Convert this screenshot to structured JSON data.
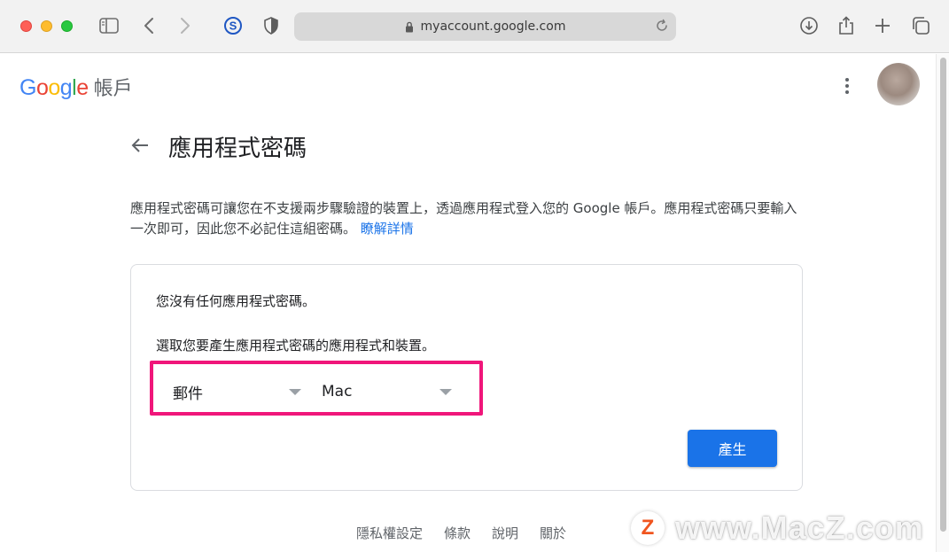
{
  "browser": {
    "url": "myaccount.google.com",
    "icons": [
      "sidebar-icon",
      "back-icon",
      "forward-icon",
      "extension-s-icon",
      "privacy-shield-icon",
      "lock-icon",
      "reload-icon",
      "download-icon",
      "share-icon",
      "new-tab-icon",
      "tab-overview-icon"
    ]
  },
  "header": {
    "logo_google": "Google",
    "logo_suffix": "帳戶"
  },
  "page": {
    "title": "應用程式密碼",
    "description": "應用程式密碼可讓您在不支援兩步驟驗證的裝置上，透過應用程式登入您的 Google 帳戶。應用程式密碼只要輸入一次即可，因此您不必記住這組密碼。",
    "learn_more": "瞭解詳情"
  },
  "card": {
    "no_passwords": "您沒有任何應用程式密碼。",
    "select_prompt": "選取您要產生應用程式密碼的應用程式和裝置。",
    "app_select": "郵件",
    "device_select": "Mac",
    "generate_button": "產生"
  },
  "footer": {
    "links": [
      "隱私權設定",
      "條款",
      "說明",
      "關於"
    ]
  },
  "watermark": {
    "badge": "Z",
    "text": "www.MacZ.com"
  },
  "colors": {
    "accent": "#1a73e8",
    "highlight": "#f0167a",
    "google_blue": "#4285F4",
    "google_red": "#EA4335",
    "google_yellow": "#FBBC05",
    "google_green": "#34A853"
  }
}
